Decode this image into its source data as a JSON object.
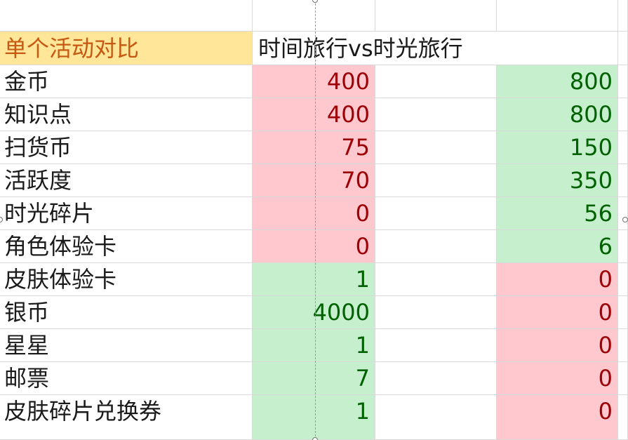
{
  "title_cell": "单个活动对比",
  "comparison_header": "时间旅行vs时光旅行",
  "rows": [
    {
      "label": "金币",
      "a": "400",
      "b": "800",
      "a_status": "bad",
      "b_status": "good"
    },
    {
      "label": "知识点",
      "a": "400",
      "b": "800",
      "a_status": "bad",
      "b_status": "good"
    },
    {
      "label": "扫货币",
      "a": "75",
      "b": "150",
      "a_status": "bad",
      "b_status": "good"
    },
    {
      "label": "活跃度",
      "a": "70",
      "b": "350",
      "a_status": "bad",
      "b_status": "good"
    },
    {
      "label": "时光碎片",
      "a": "0",
      "b": "56",
      "a_status": "bad",
      "b_status": "good"
    },
    {
      "label": "角色体验卡",
      "a": "0",
      "b": "6",
      "a_status": "bad",
      "b_status": "good"
    },
    {
      "label": "皮肤体验卡",
      "a": "1",
      "b": "0",
      "a_status": "good",
      "b_status": "bad"
    },
    {
      "label": "银币",
      "a": "4000",
      "b": "0",
      "a_status": "good",
      "b_status": "bad"
    },
    {
      "label": "星星",
      "a": "1",
      "b": "0",
      "a_status": "good",
      "b_status": "bad"
    },
    {
      "label": "邮票",
      "a": "7",
      "b": "0",
      "a_status": "good",
      "b_status": "bad"
    },
    {
      "label": "皮肤碎片兑换券",
      "a": "1",
      "b": "0",
      "a_status": "good",
      "b_status": "bad"
    }
  ],
  "colors": {
    "bad_fill": "#ffc7ce",
    "bad_text": "#9c0006",
    "good_fill": "#c6efce",
    "good_text": "#006100",
    "header_fill": "#ffe699",
    "header_text": "#c65911"
  }
}
